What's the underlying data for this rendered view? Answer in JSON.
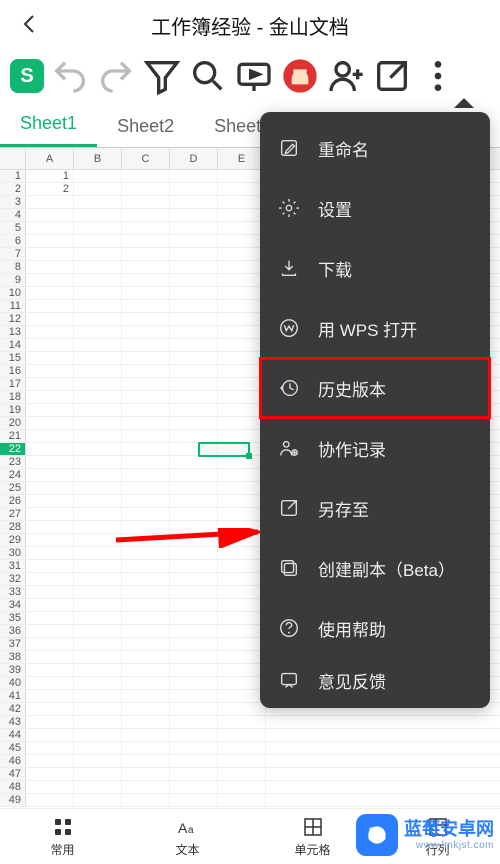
{
  "header": {
    "title": "工作簿经验 - 金山文档"
  },
  "app_logo_letter": "S",
  "tabs": [
    "Sheet1",
    "Sheet2",
    "Sheet"
  ],
  "columns": [
    "A",
    "B",
    "C",
    "D",
    "E"
  ],
  "row_count": 49,
  "cells": {
    "A1": "1",
    "A2": "2"
  },
  "selected_row": 22,
  "menu": {
    "items": [
      {
        "icon": "edit-icon",
        "label": "重命名"
      },
      {
        "icon": "gear-icon",
        "label": "设置"
      },
      {
        "icon": "download-icon",
        "label": "下载"
      },
      {
        "icon": "wps-icon",
        "label": "用 WPS 打开"
      },
      {
        "icon": "history-icon",
        "label": "历史版本",
        "highlight": true
      },
      {
        "icon": "collab-icon",
        "label": "协作记录"
      },
      {
        "icon": "saveas-icon",
        "label": "另存至"
      },
      {
        "icon": "copy-icon",
        "label": "创建副本（Beta）"
      },
      {
        "icon": "help-icon",
        "label": "使用帮助"
      },
      {
        "icon": "feedback-icon",
        "label": "意见反馈"
      }
    ]
  },
  "bottom": [
    {
      "icon": "grid-icon",
      "label": "常用"
    },
    {
      "icon": "text-icon",
      "label": "文本"
    },
    {
      "icon": "cell-icon",
      "label": "单元格"
    },
    {
      "icon": "rowcol-icon",
      "label": "行列"
    }
  ],
  "watermark": {
    "brand": "蓝莓安卓网",
    "url": "www.lmkjst.com"
  }
}
